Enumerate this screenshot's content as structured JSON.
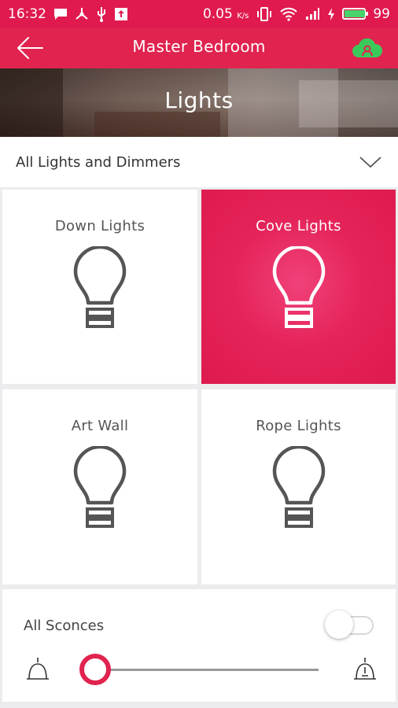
{
  "status_bar": {
    "time": "16:32",
    "data_rate": "0.05",
    "data_unit": "K/s",
    "battery_level": "99",
    "icons": [
      "message-icon",
      "usb-tether-icon",
      "usb-icon",
      "upload-icon",
      "vibrate-icon",
      "wifi-icon",
      "signal-icon",
      "charging-icon",
      "battery-icon"
    ]
  },
  "toolbar": {
    "title": "Master Bedroom",
    "back_icon": "back-arrow-icon",
    "cloud_icon": "cloud-status-icon"
  },
  "header": {
    "title": "Lights"
  },
  "filter": {
    "selected": "All Lights and Dimmers",
    "icon": "chevron-down-icon"
  },
  "tiles": [
    {
      "name": "Down Lights",
      "on": false
    },
    {
      "name": "Cove Lights",
      "on": true
    },
    {
      "name": "Art Wall",
      "on": false
    },
    {
      "name": "Rope Lights",
      "on": false
    }
  ],
  "sconces": {
    "label": "All Sconces",
    "toggle_on": false,
    "dimmer_level": 0
  },
  "colors": {
    "accent": "#e0234f",
    "status_bar": "#e01a4f",
    "tile_on": "#e5245a",
    "cloud": "#3cc95b",
    "bulb_off": "#555555"
  }
}
